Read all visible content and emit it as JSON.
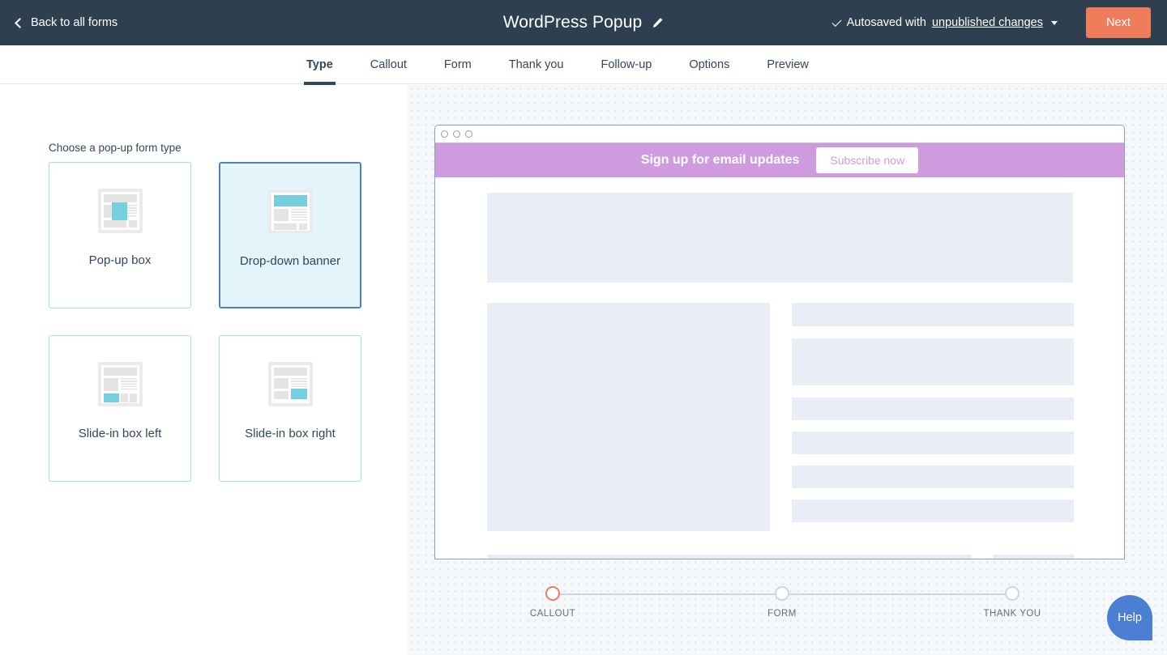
{
  "topbar": {
    "back_label": "Back to all forms",
    "back_icon": "chevron-left-icon",
    "title": "WordPress Popup",
    "edit_icon": "pencil-icon",
    "autosave_prefix": "Autosaved with",
    "autosave_link": "unpublished changes",
    "check_icon": "check-icon",
    "caret_icon": "caret-down-icon",
    "next_label": "Next",
    "bg_color": "#2e3f50",
    "next_color": "#ef7c5b"
  },
  "tabs": [
    {
      "label": "Type",
      "active": true
    },
    {
      "label": "Callout",
      "active": false
    },
    {
      "label": "Form",
      "active": false
    },
    {
      "label": "Thank you",
      "active": false
    },
    {
      "label": "Follow-up",
      "active": false
    },
    {
      "label": "Options",
      "active": false
    },
    {
      "label": "Preview",
      "active": false
    }
  ],
  "left_panel": {
    "section_label": "Choose a pop-up form type",
    "cards": [
      {
        "label": "Pop-up box",
        "icon": "popup-box-icon",
        "selected": false
      },
      {
        "label": "Drop-down banner",
        "icon": "dropdown-banner-icon",
        "selected": true
      },
      {
        "label": "Slide-in box left",
        "icon": "slide-in-left-icon",
        "selected": false
      },
      {
        "label": "Slide-in box right",
        "icon": "slide-in-right-icon",
        "selected": false
      }
    ],
    "selected_border_color": "#4f80c4",
    "selected_fill_color": "#e3f4fb",
    "card_border_color": "#a8dde3",
    "accent_teal": "#76cfde"
  },
  "preview": {
    "window_dots": 3,
    "banner": {
      "heading": "Sign up for email updates",
      "button_label": "Subscribe now",
      "bg_color": "#cf9bdf",
      "button_text_color": "#cf9bdf"
    },
    "skeleton_color": "#e9edf5"
  },
  "stepper": {
    "steps": [
      {
        "label": "CALLOUT",
        "active": true
      },
      {
        "label": "FORM",
        "active": false
      },
      {
        "label": "THANK YOU",
        "active": false
      }
    ],
    "active_color": "#ef7c5b",
    "inactive_color": "#cbd6e2"
  },
  "help": {
    "label": "Help",
    "color": "#4a7fd4"
  }
}
